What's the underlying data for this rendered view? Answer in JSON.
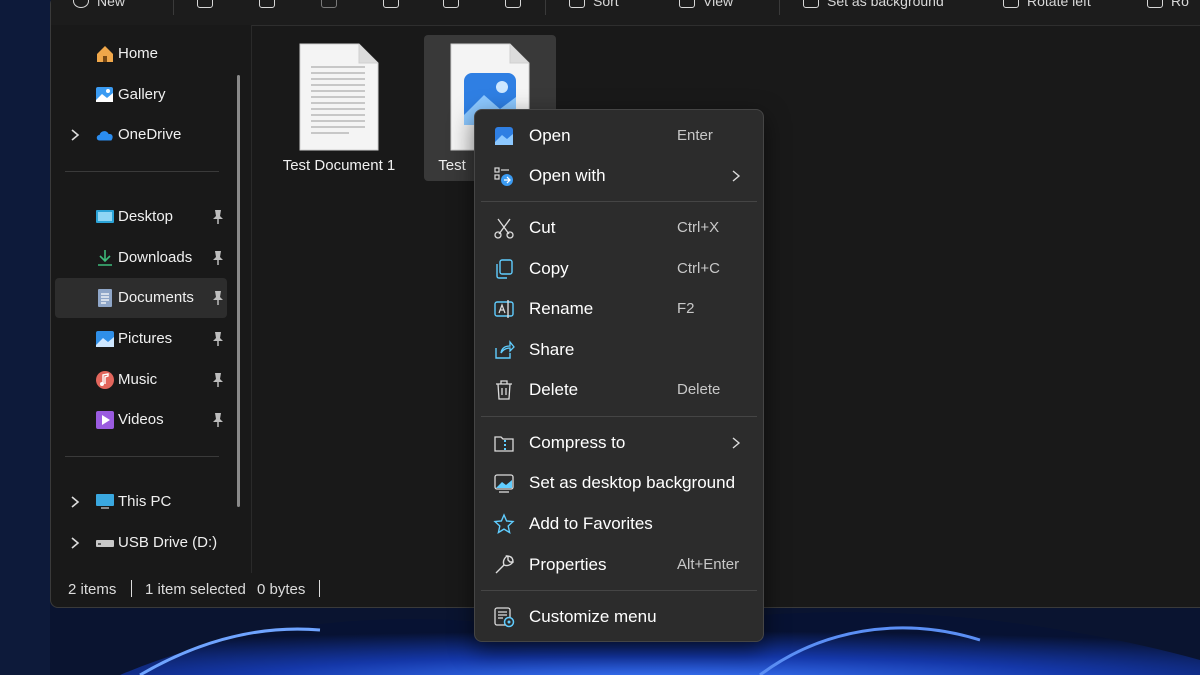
{
  "toolbar": {
    "new_label": "New",
    "sort_label": "Sort",
    "view_label": "View",
    "set_bg_label": "Set as background",
    "rotate_left_label": "Rotate left",
    "rotate_right_label": "Ro"
  },
  "nav": {
    "home": "Home",
    "gallery": "Gallery",
    "onedrive": "OneDrive",
    "desktop": "Desktop",
    "downloads": "Downloads",
    "documents": "Documents",
    "pictures": "Pictures",
    "music": "Music",
    "videos": "Videos",
    "this_pc": "This PC",
    "usb_drive": "USB Drive (D:)"
  },
  "files": [
    {
      "name": "Test Document 1",
      "icon": "text-document-icon"
    },
    {
      "name": "Test",
      "icon": "image-file-icon"
    }
  ],
  "status": {
    "items": "2 items",
    "selected": "1 item selected",
    "size": "0 bytes"
  },
  "context_menu": {
    "open": {
      "label": "Open",
      "shortcut": "Enter"
    },
    "open_with": {
      "label": "Open with"
    },
    "cut": {
      "label": "Cut",
      "shortcut": "Ctrl+X"
    },
    "copy": {
      "label": "Copy",
      "shortcut": "Ctrl+C"
    },
    "rename": {
      "label": "Rename",
      "shortcut": "F2"
    },
    "share": {
      "label": "Share"
    },
    "delete": {
      "label": "Delete",
      "shortcut": "Delete"
    },
    "compress": {
      "label": "Compress to"
    },
    "set_desktop_bg": {
      "label": "Set as desktop background"
    },
    "favorites": {
      "label": "Add to Favorites"
    },
    "properties": {
      "label": "Properties",
      "shortcut": "Alt+Enter"
    },
    "customize": {
      "label": "Customize menu"
    }
  },
  "colors": {
    "accent": "#60cdff",
    "window_bg": "#191919",
    "menu_bg": "#2c2c2c",
    "wallpaper": "#0b1a3e"
  }
}
